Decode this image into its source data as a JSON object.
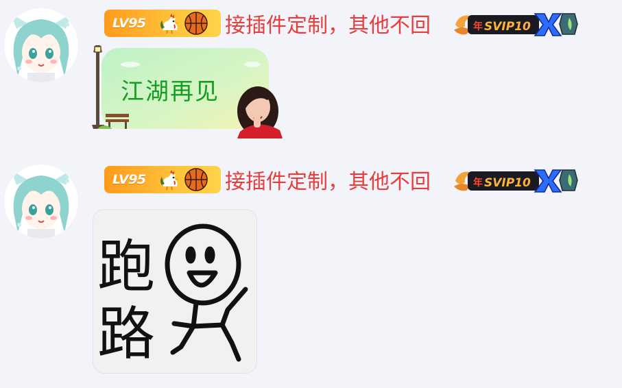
{
  "messages": [
    {
      "level_badge": "LV95",
      "nickname": "接插件定制，其他不回",
      "vip_badge": "年SVIP10",
      "bubble_text": "江湖再见"
    },
    {
      "level_badge": "LV95",
      "nickname": "接插件定制，其他不回",
      "vip_badge": "年SVIP10",
      "sticker_text": [
        "跑",
        "路"
      ]
    }
  ],
  "colors": {
    "background": "#f3f4f9",
    "nickname": "#e63d3d",
    "bubble_text": "#159d23",
    "level_badge": "#ffb12a"
  }
}
